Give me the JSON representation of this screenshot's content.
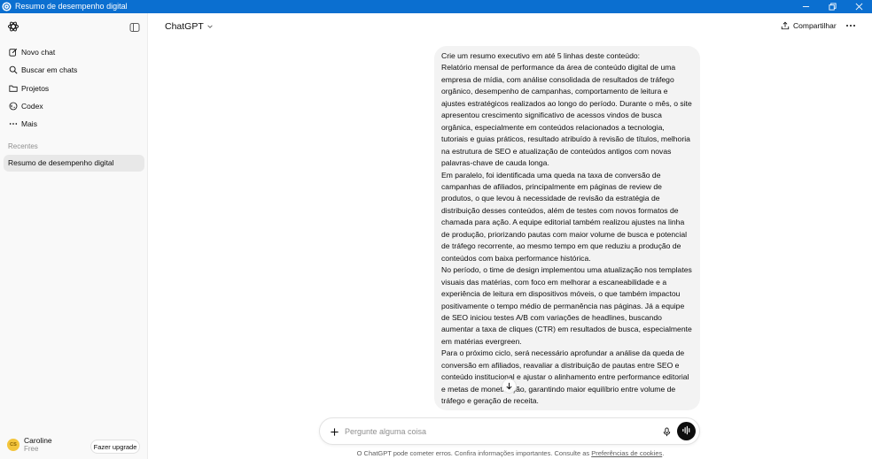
{
  "window": {
    "title": "Resumo de desempenho digital",
    "controls": [
      "minimize-icon",
      "restore-icon",
      "close-icon"
    ]
  },
  "sidebar": {
    "nav": [
      {
        "label": "Novo chat",
        "icon": "new-chat-icon"
      },
      {
        "label": "Buscar em chats",
        "icon": "search-icon"
      },
      {
        "label": "Projetos",
        "icon": "folder-icon"
      },
      {
        "label": "Codex",
        "icon": "codex-icon"
      },
      {
        "label": "Mais",
        "icon": "more-horizontal-icon"
      }
    ],
    "recents_label": "Recentes",
    "recents": [
      {
        "label": "Resumo de desempenho digital",
        "active": true
      }
    ],
    "user": {
      "initials": "CS",
      "name": "Caroline",
      "plan": "Free",
      "upgrade_label": "Fazer upgrade"
    }
  },
  "header": {
    "model": "ChatGPT",
    "share_label": "Compartilhar"
  },
  "conversation": {
    "user_message": [
      "Crie um resumo executivo em até 5 linhas deste conteúdo:",
      "Relatório mensal de performance da área de conteúdo digital de uma empresa de mídia, com análise consolidada de resultados de tráfego orgânico, desempenho de campanhas, comportamento de leitura e ajustes estratégicos realizados ao longo do período. Durante o mês, o site apresentou crescimento significativo de acessos vindos de busca orgânica, especialmente em conteúdos relacionados a tecnologia, tutoriais e guias práticos, resultado atribuído à revisão de títulos, melhoria na estrutura de SEO e atualização de conteúdos antigos com novas palavras-chave de cauda longa.",
      "Em paralelo, foi identificada uma queda na taxa de conversão de campanhas de afiliados, principalmente em páginas de review de produtos, o que levou à necessidade de revisão da estratégia de distribuição desses conteúdos, além de testes com novos formatos de chamada para ação. A equipe editorial também realizou ajustes na linha de produção, priorizando pautas com maior volume de busca e potencial de tráfego recorrente, ao mesmo tempo em que reduziu a produção de conteúdos com baixa performance histórica.",
      "No período, o time de design implementou uma atualização nos templates visuais das matérias, com foco em melhorar a escaneabilidade e a experiência de leitura em dispositivos móveis, o que também impactou positivamente o tempo médio de permanência nas páginas. Já a equipe de SEO iniciou testes A/B com variações de headlines, buscando aumentar a taxa de cliques (CTR) em resultados de busca, especialmente em matérias evergreen.",
      "Para o próximo ciclo, será necessário aprofundar a análise da queda de conversão em afiliados, reavaliar a distribuição de pautas entre SEO e conteúdo institucional e ajustar o alinhamento entre performance editorial e metas de monetização, garantindo maior equilíbrio entre volume de tráfego e geração de receita."
    ]
  },
  "composer": {
    "placeholder": "Pergunte alguma coisa"
  },
  "footer": {
    "disclaimer": "O ChatGPT pode cometer erros. Confira informações importantes. Consulte as ",
    "link": "Preferências de cookies",
    "suffix": "."
  }
}
